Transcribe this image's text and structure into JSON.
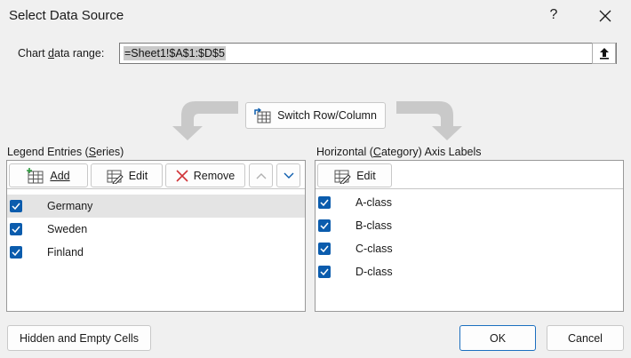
{
  "window": {
    "title": "Select Data Source",
    "help_glyph": "?",
    "close_glyph": "✕"
  },
  "range": {
    "label": "Chart data range:",
    "value": "=Sheet1!$A$1:$D$5"
  },
  "switch_button": {
    "label": "Switch Row/Column"
  },
  "legend": {
    "header": "Legend Entries (Series)",
    "toolbar": {
      "add": "Add",
      "edit": "Edit",
      "remove": "Remove"
    },
    "items": [
      {
        "label": "Germany",
        "checked": true,
        "selected": true
      },
      {
        "label": "Sweden",
        "checked": true,
        "selected": false
      },
      {
        "label": "Finland",
        "checked": true,
        "selected": false
      }
    ]
  },
  "axis": {
    "header": "Horizontal (Category) Axis Labels",
    "toolbar": {
      "edit": "Edit"
    },
    "items": [
      {
        "label": "A-class",
        "checked": true
      },
      {
        "label": "B-class",
        "checked": true
      },
      {
        "label": "C-class",
        "checked": true
      },
      {
        "label": "D-class",
        "checked": true
      }
    ]
  },
  "footer": {
    "hidden_cells": "Hidden and Empty Cells",
    "ok": "OK",
    "cancel": "Cancel"
  },
  "colors": {
    "accent": "#0b5cad",
    "remove_red": "#d13438",
    "dialog_bg": "#f0f0f0"
  }
}
